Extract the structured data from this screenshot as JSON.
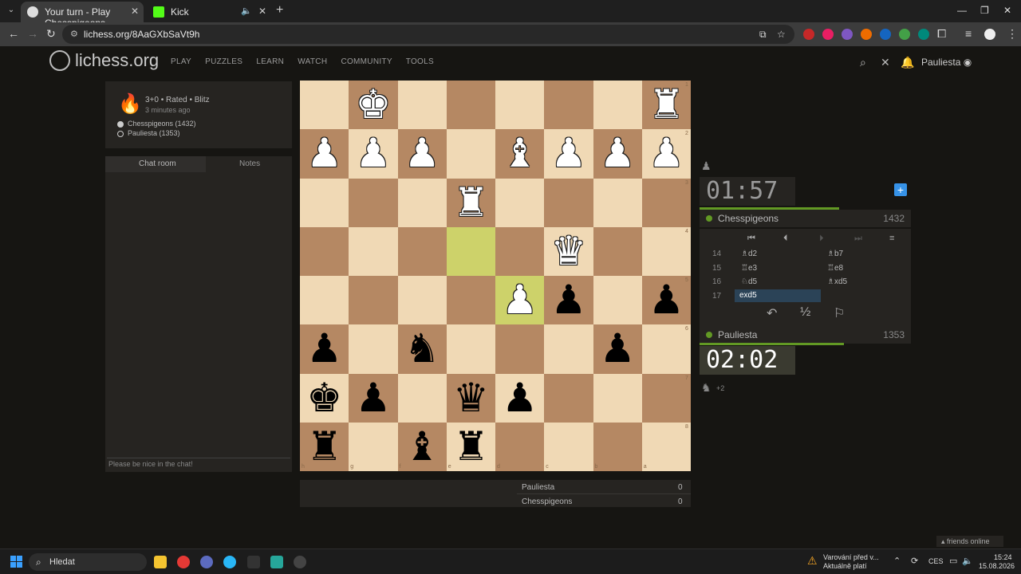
{
  "browser": {
    "tabs": [
      {
        "title": "Your turn - Play Chesspigeons -",
        "active": true
      },
      {
        "title": "Kick",
        "active": false
      }
    ],
    "url": "lichess.org/8AaGXbSaVt9h"
  },
  "site": {
    "logo": "lichess.org",
    "nav": [
      "PLAY",
      "PUZZLES",
      "LEARN",
      "WATCH",
      "COMMUNITY",
      "TOOLS"
    ],
    "username": "Pauliesta"
  },
  "game": {
    "mode": "3+0 • Rated • Blitz",
    "time_ago": "3 minutes ago",
    "players": [
      "Chesspigeons (1432)",
      "Pauliesta (1353)"
    ]
  },
  "chat": {
    "tab_chat": "Chat room",
    "tab_notes": "Notes",
    "placeholder": "Please be nice in the chat!"
  },
  "board": {
    "ranks": [
      "1",
      "2",
      "3",
      "4",
      "5",
      "6",
      "7",
      "8"
    ],
    "files": [
      "h",
      "g",
      "f",
      "e",
      "d",
      "c",
      "b",
      "a"
    ],
    "squares": [
      [
        "",
        "K",
        "",
        "",
        "",
        "",
        "",
        "R"
      ],
      [
        "P",
        "P",
        "P",
        "",
        "B",
        "P",
        "P",
        "P"
      ],
      [
        "",
        "",
        "",
        "R",
        "",
        "",
        "",
        ""
      ],
      [
        "",
        "",
        "",
        "",
        "",
        "Q",
        "",
        ""
      ],
      [
        "",
        "",
        "",
        "",
        "P",
        "p",
        "",
        "p"
      ],
      [
        "p",
        "",
        "n",
        "",
        "",
        "",
        "p",
        ""
      ],
      [
        "k",
        "p",
        "",
        "q",
        "p",
        "",
        "",
        ""
      ],
      [
        "r",
        "",
        "b",
        "r",
        "",
        "",
        "",
        ""
      ]
    ],
    "highlighted": [
      [
        3,
        3
      ],
      [
        4,
        4
      ]
    ]
  },
  "clocks": {
    "opponent": "01:57",
    "me": "02:02"
  },
  "opponent": {
    "name": "Chesspigeons",
    "rating": "1432"
  },
  "me": {
    "name": "Pauliesta",
    "rating": "1353",
    "material": "+2"
  },
  "moves": [
    {
      "num": "14",
      "white": "♗d2",
      "black": "♗b7"
    },
    {
      "num": "15",
      "white": "♖e3",
      "black": "♖e8"
    },
    {
      "num": "16",
      "white": "♘d5",
      "black": "♗xd5"
    },
    {
      "num": "17",
      "white": "exd5",
      "black": ""
    }
  ],
  "actions": {
    "draw": "½"
  },
  "score_table": [
    {
      "name": "Pauliesta",
      "score": "0"
    },
    {
      "name": "Chesspigeons",
      "score": "0"
    }
  ],
  "friends": "friends online",
  "taskbar": {
    "search": "Hledat",
    "notification": "Varování před v...",
    "notification2": "Aktuálně platí",
    "lang": "CES",
    "time": "15:24",
    "date": "15.08.2026"
  },
  "colors": {
    "accent": "#629924",
    "highlight": "#cdd26a",
    "light": "#f0d9b5",
    "dark": "#b58863"
  }
}
